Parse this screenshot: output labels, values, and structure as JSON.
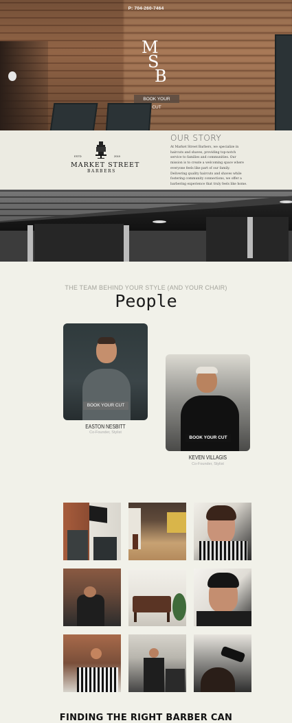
{
  "header": {
    "phone": "P: 704-260-7464"
  },
  "hero": {
    "monogram": {
      "m": "M",
      "s": "S",
      "b": "B"
    },
    "book_button": "BOOK YOUR CUT"
  },
  "logo": {
    "est_left": "ESTD",
    "est_right": "2019",
    "name": "MARKET STREET",
    "sub": "BARBERS"
  },
  "story": {
    "title": "OUR STORY",
    "text": "At Market Street Barbers, we specialize in haircuts and shaves, providing top-notch service to families and communities. Our mission is to create a welcoming space where everyone feels like part of our family. Delivering quality haircuts and shaves while fostering community connections, we offer a barbering experience that truly feels like home."
  },
  "team": {
    "subtitle": "THE TEAM BEHIND YOUR STYLE (AND YOUR CHAIR)",
    "title": "People",
    "members": [
      {
        "name": "EASTON NESBITT",
        "role": "Co-Founder, Stylist",
        "button": "BOOK YOUR CUT"
      },
      {
        "name": "KEVEN VILLAGIS",
        "role": "Co-Founder, Stylist",
        "button": "BOOK YOUR CUT"
      }
    ]
  },
  "gallery": {
    "items": [
      "storefront",
      "shop-interior",
      "haircut-side",
      "barber-chair",
      "waiting-bench",
      "fade-haircut",
      "barber-cutting",
      "barber-shop-cut",
      "clipper-cut"
    ]
  },
  "footer": {
    "heading": "FINDING THE RIGHT BARBER CAN"
  }
}
